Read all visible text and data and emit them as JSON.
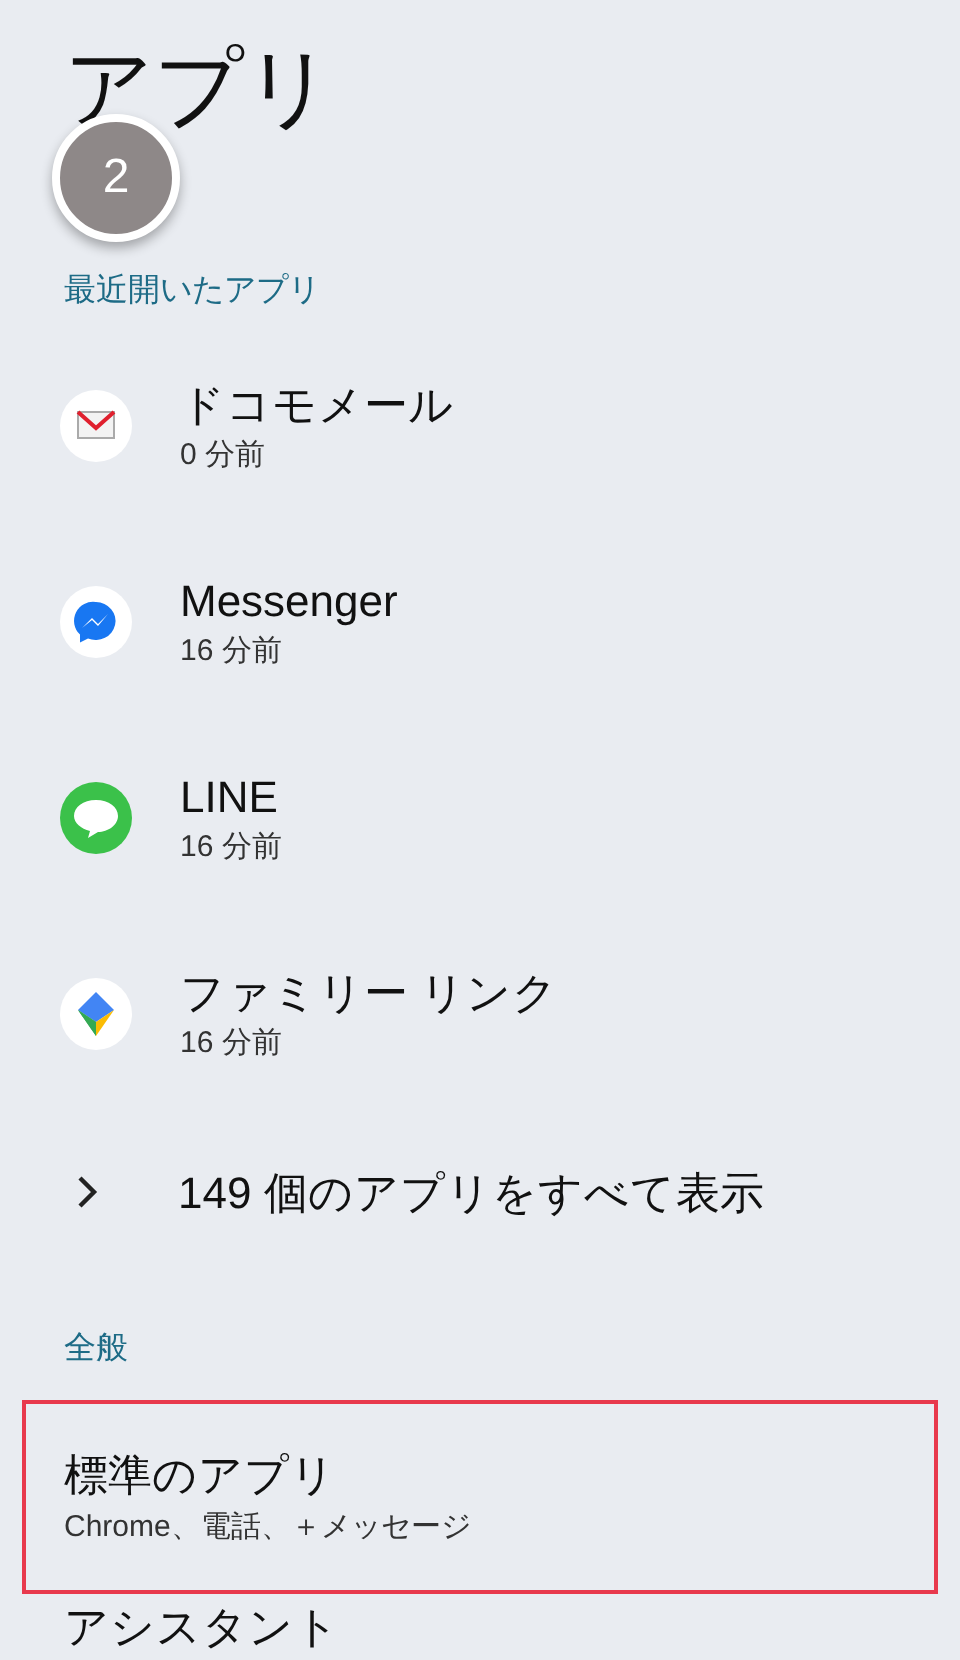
{
  "title": "アプリ",
  "step_badge": "2",
  "recent_section": {
    "header": "最近開いたアプリ",
    "apps": [
      {
        "kind": "mail",
        "name": "ドコモメール",
        "last_opened": "0 分前"
      },
      {
        "kind": "messenger",
        "name": "Messenger",
        "last_opened": "16 分前"
      },
      {
        "kind": "line",
        "name": "LINE",
        "last_opened": "16 分前"
      },
      {
        "kind": "family_link",
        "name": "ファミリー リンク",
        "last_opened": "16 分前"
      }
    ],
    "show_all": "149 個のアプリをすべて表示"
  },
  "general_section": {
    "header": "全般",
    "items": [
      {
        "title": "標準のアプリ",
        "summary": "Chrome、電話、＋メッセージ",
        "highlighted": true
      },
      {
        "title": "アシスタント",
        "highlighted": false
      }
    ]
  }
}
